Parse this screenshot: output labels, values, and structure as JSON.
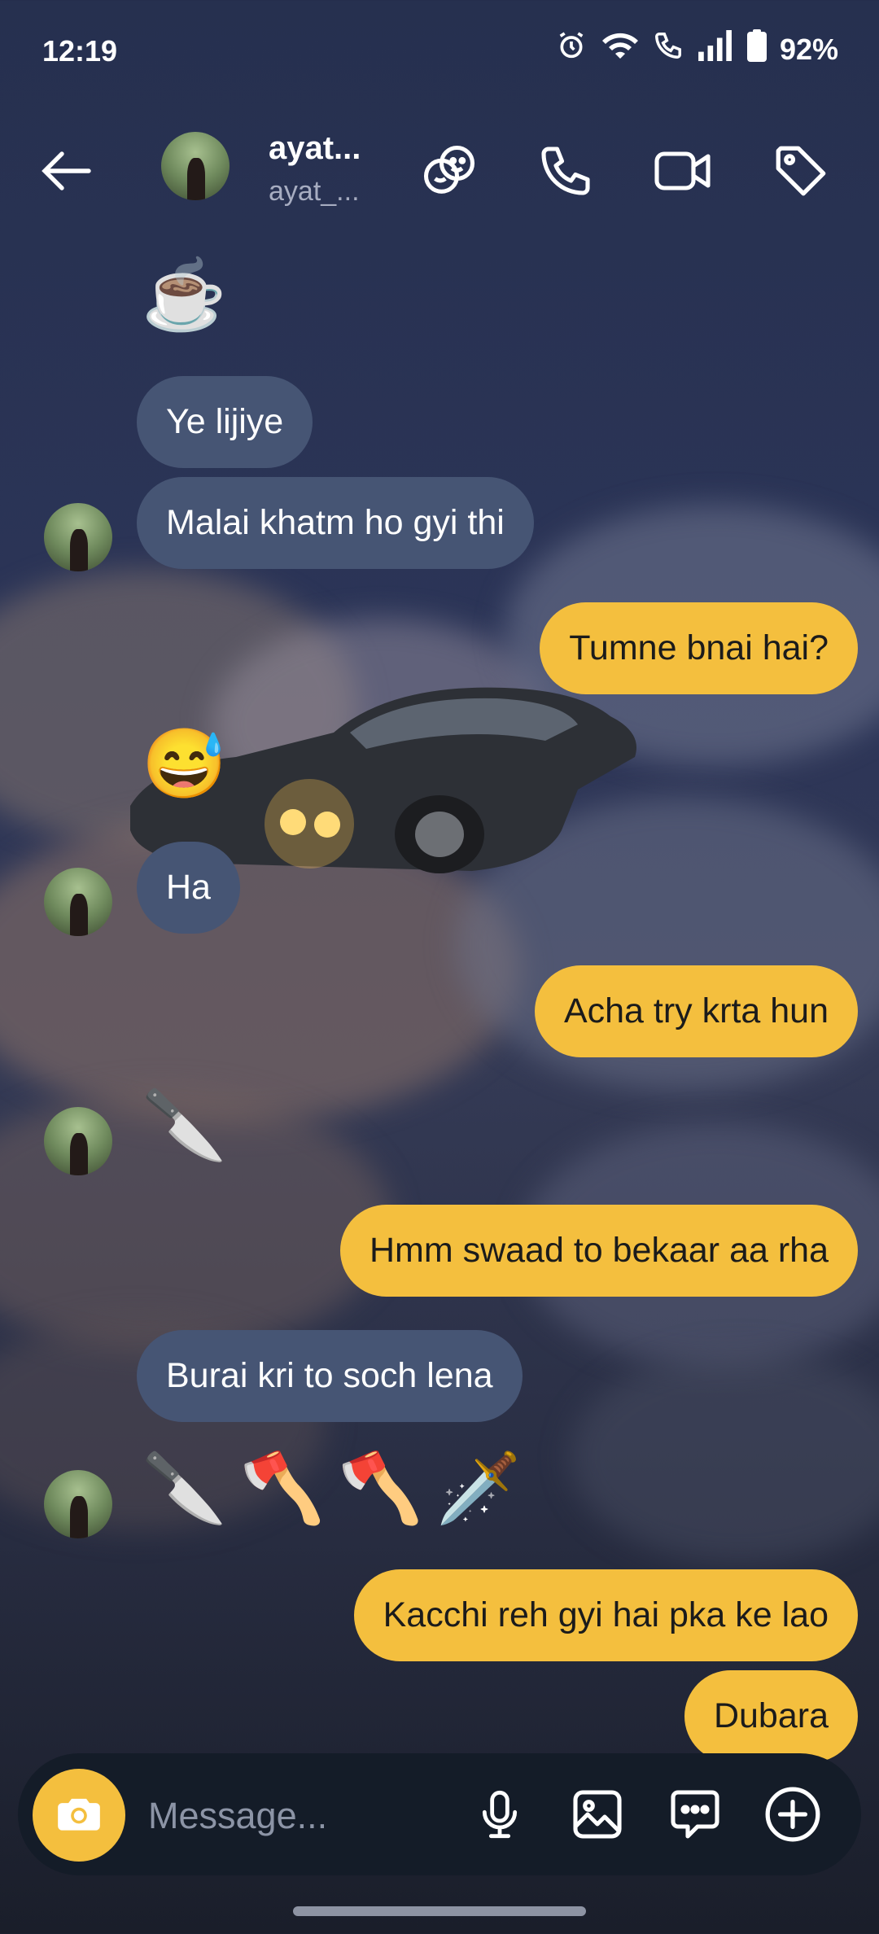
{
  "status_bar": {
    "time": "12:19",
    "battery": "92%"
  },
  "header": {
    "name": "ayat...",
    "handle": "ayat_..."
  },
  "messages": [
    {
      "side": "in",
      "type": "emoji",
      "text": "☕"
    },
    {
      "side": "in",
      "type": "text",
      "text": "Ye lijiye"
    },
    {
      "side": "in",
      "type": "text",
      "text": "Malai khatm ho gyi thi"
    },
    {
      "side": "out",
      "type": "text",
      "text": "Tumne bnai hai?"
    },
    {
      "side": "in",
      "type": "emoji",
      "text": "😅"
    },
    {
      "side": "in",
      "type": "text",
      "text": "Ha"
    },
    {
      "side": "out",
      "type": "text",
      "text": "Acha try krta hun"
    },
    {
      "side": "in",
      "type": "emoji",
      "text": "🔪"
    },
    {
      "side": "out",
      "type": "text",
      "text": "Hmm swaad to bekaar aa rha"
    },
    {
      "side": "in",
      "type": "text",
      "text": "Burai kri to soch lena"
    },
    {
      "side": "in",
      "type": "emoji",
      "text": "🔪🪓🪓🗡️"
    },
    {
      "side": "out",
      "type": "text",
      "text": "Kacchi reh gyi hai pka ke lao"
    },
    {
      "side": "out",
      "type": "text",
      "text": "Dubara"
    }
  ],
  "composer": {
    "placeholder": "Message..."
  },
  "icons": {
    "back": "arrow-left-icon",
    "theme": "sticker-faces-icon",
    "call": "phone-icon",
    "video": "video-camera-icon",
    "tag": "tag-icon",
    "camera": "camera-icon",
    "mic": "microphone-icon",
    "gallery": "image-icon",
    "chat": "chat-bubble-icon",
    "add": "plus-circle-icon"
  },
  "colors": {
    "incoming_bubble": "#465574",
    "outgoing_bubble": "#f4bf3e",
    "camera_button": "#f4bf3e"
  }
}
